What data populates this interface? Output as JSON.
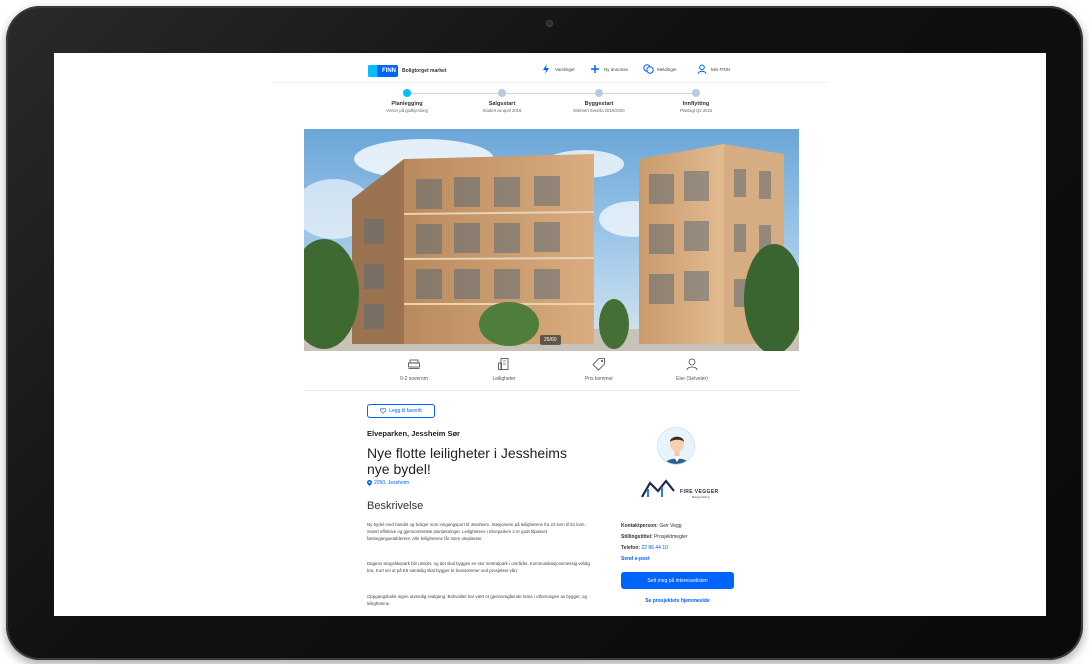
{
  "header": {
    "logo_mark": "FINN",
    "logo_text": "Boligtorget market",
    "nav": [
      {
        "icon": "lightning-icon",
        "label": "Varslinger"
      },
      {
        "icon": "plus-icon",
        "label": "Ny annonse"
      },
      {
        "icon": "chat-icon",
        "label": "Meldinger"
      },
      {
        "icon": "user-icon",
        "label": "Min FINN"
      }
    ]
  },
  "stepper": [
    {
      "title": "Planlegging",
      "subtitle": "Venter på godkjenning",
      "active": true
    },
    {
      "title": "Salgsstart",
      "subtitle": "Studert av april 2019",
      "active": false
    },
    {
      "title": "Byggestart",
      "subtitle": "Estimert Sesella 2019/2020",
      "active": false
    },
    {
      "title": "Innflytting",
      "subtitle": "Planlagt Q2 2022",
      "active": false
    }
  ],
  "hero": {
    "badge": "25/60"
  },
  "facts": [
    {
      "icon": "bed-icon",
      "label": "0-2 soverom"
    },
    {
      "icon": "building-icon",
      "label": "Leiligheter"
    },
    {
      "icon": "price-tag-icon",
      "label": "Pris kommer"
    },
    {
      "icon": "owner-icon",
      "label": "Eier (Selveier)"
    }
  ],
  "main": {
    "favorite_label": "Legg til favoritt",
    "address": "Elveparken, Jessheim Sør",
    "title": "Nye flotte leiligheter i Jessheims nye bydel!",
    "location": "2050, Jessheim",
    "section_title": "Beskrivelse",
    "paragraphs": [
      "Ny bydel med handel og boliger som inngangsport til Jessheim. Stasjonene på leilighetene fra 23 kvm til 81 kvm. Svært effektive og gjennomtenkte planløsninger. Leilighetene i Elveparken 2 er godt tilpasset førstegangsetablerere. Alle leilighetene får store uteplasser.",
      "Dagens skogslikepark blir utvidet, og det skal bygges en stor sentralpark i området. Kommunikasjonsmessig veldig bra. Kort vei ut på E6 samtidig skal bygger to busstommer ved prosjektet vårt.",
      "Oppgangsbokk ingen utvendig svalgang. Bokvalitet har vært et gjennomgående tema i utformingen av bygget, og leilighetene."
    ]
  },
  "contact": {
    "brand": "FIRE VEGGER",
    "brand_sub": "Boligutvikling",
    "person_label": "Kontaktperson:",
    "person_value": "Geir Vegg",
    "position_label": "Stillingstittel:",
    "position_value": "Prosjektmegler",
    "phone_label": "Telefon:",
    "phone_value": "22 86 44 10",
    "email_link": "Send e-post",
    "cta_label": "Sett meg på interesselisten",
    "project_link": "Se prosjektets hjemmeside"
  },
  "colors": {
    "accent": "#0063fb",
    "accent_light": "#06befb"
  }
}
